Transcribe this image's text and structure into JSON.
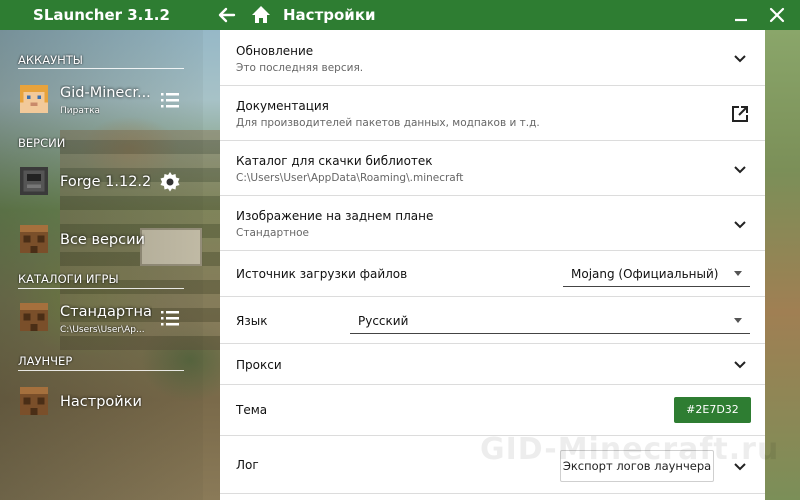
{
  "app": {
    "title": "SLauncher 3.1.2",
    "page_title": "Настройки"
  },
  "sidebar": {
    "sections": {
      "accounts": "АККАУНТЫ",
      "versions": "ВЕРСИИ",
      "game_dirs": "КАТАЛОГИ ИГРЫ",
      "launcher": "ЛАУНЧЕР"
    },
    "account": {
      "name": "Gid-Minecr...",
      "type": "Пиратка"
    },
    "versions": [
      {
        "name": "Forge 1.12.2"
      },
      {
        "name": "Все версии"
      }
    ],
    "game_dir": {
      "name": "Стандартная",
      "path": "C:\\Users\\User\\Ap..."
    },
    "launcher_item": {
      "name": "Настройки"
    }
  },
  "settings": {
    "update": {
      "title": "Обновление",
      "subtitle": "Это последняя версия."
    },
    "docs": {
      "title": "Документация",
      "subtitle": "Для производителей пакетов данных, модпаков и т.д."
    },
    "lib_dir": {
      "title": "Каталог для скачки библиотек",
      "subtitle": "C:\\Users\\User\\AppData\\Roaming\\.minecraft"
    },
    "background": {
      "title": "Изображение на заднем плане",
      "subtitle": "Стандартное"
    },
    "download_source": {
      "title": "Источник загрузки файлов",
      "value": "Mojang (Официальный)"
    },
    "language": {
      "title": "Язык",
      "value": "Русский"
    },
    "proxy": {
      "title": "Прокси"
    },
    "theme": {
      "title": "Тема",
      "value": "#2E7D32"
    },
    "log": {
      "title": "Лог",
      "button": "Экспорт логов лаунчера"
    }
  },
  "watermark": "GID-Minecraft.ru",
  "colors": {
    "accent": "#2E7D32",
    "panel": "#FFFFFF"
  },
  "icons": [
    "back-arrow-icon",
    "home-icon",
    "minimize-icon",
    "close-icon",
    "list-icon",
    "gear-icon",
    "chevron-down-icon",
    "external-link-icon"
  ]
}
